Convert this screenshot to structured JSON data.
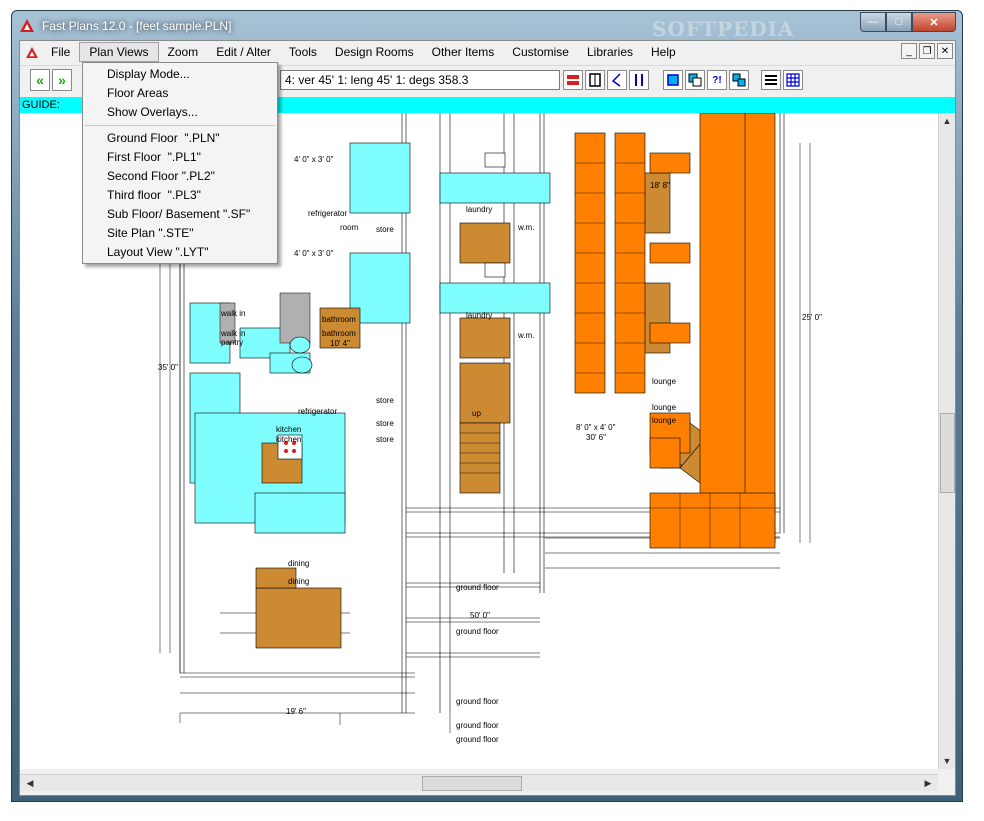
{
  "window": {
    "title": "Fast Plans 12.0 - [feet sample.PLN]",
    "watermark": "SOFTPEDIA"
  },
  "menubar": {
    "items": [
      "File",
      "Plan Views",
      "Zoom",
      "Edit / Alter",
      "Tools",
      "Design Rooms",
      "Other Items",
      "Customise",
      "Libraries",
      "Help"
    ],
    "active_index": 1
  },
  "plan_views_menu": {
    "items": [
      "Display Mode...",
      "Floor Areas",
      "Show Overlays..."
    ],
    "views": [
      "Ground Floor  \".PLN\"",
      "First Floor  \".PL1\"",
      "Second Floor \".PL2\"",
      "Third floor  \".PL3\"",
      "Sub Floor/ Basement \".SF\"",
      "Site Plan \".STE\"",
      "Layout View \".LYT\""
    ]
  },
  "toolbar": {
    "status_text": "4: ver 45' 1: leng 45' 1: degs 358.3",
    "nav_left_icon": "double-chevron-left-icon",
    "nav_right_icon": "double-chevron-right-icon"
  },
  "guide": {
    "label": "GUIDE:"
  },
  "plan_labels": {
    "rooms": [
      "laundry",
      "laundry",
      "refrigerator",
      "refrigerator",
      "store",
      "store",
      "store",
      "store",
      "w.m.",
      "w.m.",
      "room",
      "walk in",
      "walk in",
      "pantry",
      "bathroom",
      "bathroom",
      "kitchen",
      "kitchen",
      "dining",
      "dining",
      "up",
      "lounge",
      "lounge",
      "lounge",
      "ground floor",
      "ground floor",
      "ground floor",
      "ground floor",
      "ground floor"
    ],
    "dimensions": [
      "4' 0\" x 3' 0\"",
      "4' 0\" x 3' 0\"",
      "18' 8\"",
      "8' 0\" x 4' 0\"",
      "30' 6\"",
      "50' 0\"",
      "19' 6\"",
      "10' 4\"",
      "25' 0\"",
      "35' 0\""
    ]
  },
  "colors": {
    "cyan": "#7ffeff",
    "orange": "#ff8000",
    "brown": "#cc8a33",
    "guide": "#00ffff"
  }
}
